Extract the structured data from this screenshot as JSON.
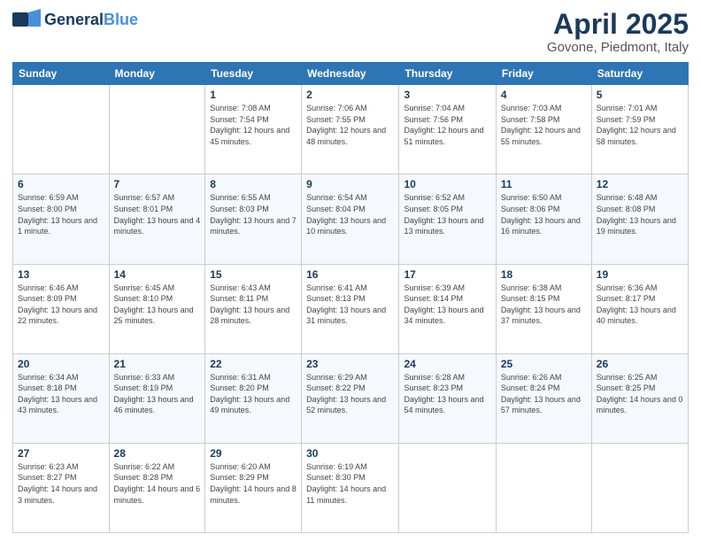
{
  "header": {
    "logo_general": "General",
    "logo_blue": "Blue",
    "month_title": "April 2025",
    "location": "Govone, Piedmont, Italy"
  },
  "days_of_week": [
    "Sunday",
    "Monday",
    "Tuesday",
    "Wednesday",
    "Thursday",
    "Friday",
    "Saturday"
  ],
  "weeks": [
    [
      {
        "day": "",
        "info": ""
      },
      {
        "day": "",
        "info": ""
      },
      {
        "day": "1",
        "info": "Sunrise: 7:08 AM\nSunset: 7:54 PM\nDaylight: 12 hours and 45 minutes."
      },
      {
        "day": "2",
        "info": "Sunrise: 7:06 AM\nSunset: 7:55 PM\nDaylight: 12 hours and 48 minutes."
      },
      {
        "day": "3",
        "info": "Sunrise: 7:04 AM\nSunset: 7:56 PM\nDaylight: 12 hours and 51 minutes."
      },
      {
        "day": "4",
        "info": "Sunrise: 7:03 AM\nSunset: 7:58 PM\nDaylight: 12 hours and 55 minutes."
      },
      {
        "day": "5",
        "info": "Sunrise: 7:01 AM\nSunset: 7:59 PM\nDaylight: 12 hours and 58 minutes."
      }
    ],
    [
      {
        "day": "6",
        "info": "Sunrise: 6:59 AM\nSunset: 8:00 PM\nDaylight: 13 hours and 1 minute."
      },
      {
        "day": "7",
        "info": "Sunrise: 6:57 AM\nSunset: 8:01 PM\nDaylight: 13 hours and 4 minutes."
      },
      {
        "day": "8",
        "info": "Sunrise: 6:55 AM\nSunset: 8:03 PM\nDaylight: 13 hours and 7 minutes."
      },
      {
        "day": "9",
        "info": "Sunrise: 6:54 AM\nSunset: 8:04 PM\nDaylight: 13 hours and 10 minutes."
      },
      {
        "day": "10",
        "info": "Sunrise: 6:52 AM\nSunset: 8:05 PM\nDaylight: 13 hours and 13 minutes."
      },
      {
        "day": "11",
        "info": "Sunrise: 6:50 AM\nSunset: 8:06 PM\nDaylight: 13 hours and 16 minutes."
      },
      {
        "day": "12",
        "info": "Sunrise: 6:48 AM\nSunset: 8:08 PM\nDaylight: 13 hours and 19 minutes."
      }
    ],
    [
      {
        "day": "13",
        "info": "Sunrise: 6:46 AM\nSunset: 8:09 PM\nDaylight: 13 hours and 22 minutes."
      },
      {
        "day": "14",
        "info": "Sunrise: 6:45 AM\nSunset: 8:10 PM\nDaylight: 13 hours and 25 minutes."
      },
      {
        "day": "15",
        "info": "Sunrise: 6:43 AM\nSunset: 8:11 PM\nDaylight: 13 hours and 28 minutes."
      },
      {
        "day": "16",
        "info": "Sunrise: 6:41 AM\nSunset: 8:13 PM\nDaylight: 13 hours and 31 minutes."
      },
      {
        "day": "17",
        "info": "Sunrise: 6:39 AM\nSunset: 8:14 PM\nDaylight: 13 hours and 34 minutes."
      },
      {
        "day": "18",
        "info": "Sunrise: 6:38 AM\nSunset: 8:15 PM\nDaylight: 13 hours and 37 minutes."
      },
      {
        "day": "19",
        "info": "Sunrise: 6:36 AM\nSunset: 8:17 PM\nDaylight: 13 hours and 40 minutes."
      }
    ],
    [
      {
        "day": "20",
        "info": "Sunrise: 6:34 AM\nSunset: 8:18 PM\nDaylight: 13 hours and 43 minutes."
      },
      {
        "day": "21",
        "info": "Sunrise: 6:33 AM\nSunset: 8:19 PM\nDaylight: 13 hours and 46 minutes."
      },
      {
        "day": "22",
        "info": "Sunrise: 6:31 AM\nSunset: 8:20 PM\nDaylight: 13 hours and 49 minutes."
      },
      {
        "day": "23",
        "info": "Sunrise: 6:29 AM\nSunset: 8:22 PM\nDaylight: 13 hours and 52 minutes."
      },
      {
        "day": "24",
        "info": "Sunrise: 6:28 AM\nSunset: 8:23 PM\nDaylight: 13 hours and 54 minutes."
      },
      {
        "day": "25",
        "info": "Sunrise: 6:26 AM\nSunset: 8:24 PM\nDaylight: 13 hours and 57 minutes."
      },
      {
        "day": "26",
        "info": "Sunrise: 6:25 AM\nSunset: 8:25 PM\nDaylight: 14 hours and 0 minutes."
      }
    ],
    [
      {
        "day": "27",
        "info": "Sunrise: 6:23 AM\nSunset: 8:27 PM\nDaylight: 14 hours and 3 minutes."
      },
      {
        "day": "28",
        "info": "Sunrise: 6:22 AM\nSunset: 8:28 PM\nDaylight: 14 hours and 6 minutes."
      },
      {
        "day": "29",
        "info": "Sunrise: 6:20 AM\nSunset: 8:29 PM\nDaylight: 14 hours and 8 minutes."
      },
      {
        "day": "30",
        "info": "Sunrise: 6:19 AM\nSunset: 8:30 PM\nDaylight: 14 hours and 11 minutes."
      },
      {
        "day": "",
        "info": ""
      },
      {
        "day": "",
        "info": ""
      },
      {
        "day": "",
        "info": ""
      }
    ]
  ]
}
